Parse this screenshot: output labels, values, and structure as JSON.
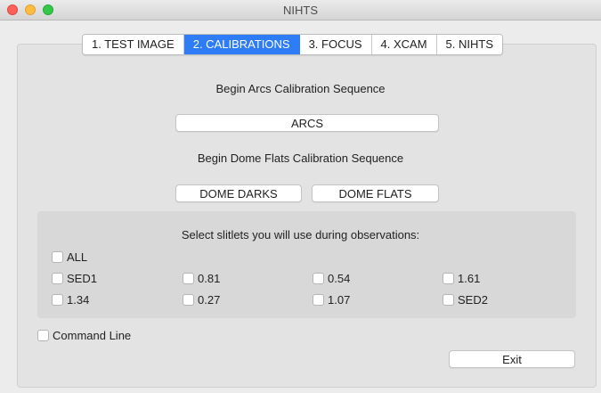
{
  "window": {
    "title": "NIHTS"
  },
  "tabs": [
    {
      "label": "1. TEST IMAGE",
      "active": false
    },
    {
      "label": "2. CALIBRATIONS",
      "active": true
    },
    {
      "label": "3. FOCUS",
      "active": false
    },
    {
      "label": "4. XCAM",
      "active": false
    },
    {
      "label": "5. NIHTS",
      "active": false
    }
  ],
  "arcs": {
    "heading": "Begin Arcs Calibration Sequence",
    "button": "ARCS"
  },
  "dome": {
    "heading": "Begin Dome Flats Calibration Sequence",
    "darks_button": "DOME DARKS",
    "flats_button": "DOME FLATS"
  },
  "slitlets": {
    "heading": "Select slitlets you will use during observations:",
    "all": "ALL",
    "options": [
      "SED1",
      "0.81",
      "0.54",
      "1.61",
      "1.34",
      "0.27",
      "1.07",
      "SED2"
    ]
  },
  "command_line": "Command Line",
  "exit_button": "Exit",
  "colors": {
    "accent": "#2e7cf6",
    "window_bg": "#ececec",
    "group_bg": "#d8d8d8"
  }
}
